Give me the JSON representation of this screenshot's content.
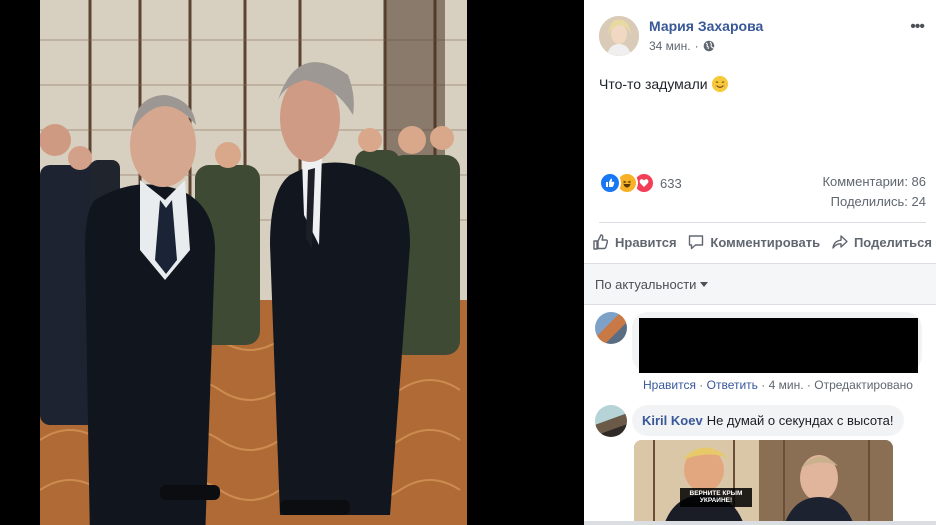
{
  "viewer": {
    "photo_icon": "photo-of-two-men-in-suits-talking",
    "background": "#000000"
  },
  "post": {
    "author": "Мария Захарова",
    "time": "34 мин.",
    "privacy_icon": "globe-icon",
    "more_label": "•••",
    "text": "Что-то задумали",
    "text_emoji": "smile-emoji-icon"
  },
  "reactions": {
    "count": "633",
    "types": [
      "like-icon",
      "haha-icon",
      "love-icon"
    ],
    "colors": {
      "like": "#1877f2",
      "haha": "#f7b125",
      "love": "#f33e58"
    }
  },
  "stats": {
    "comments": "Комментарии: 86",
    "shares": "Поделились: 24"
  },
  "actions": {
    "like": "Нравится",
    "comment": "Комментировать",
    "share": "Поделиться"
  },
  "sort": {
    "label": "По актуальности"
  },
  "comments": [
    {
      "like": "Нравится",
      "reply": "Ответить",
      "separator": "·",
      "time": "4 мин.",
      "edited": "Отредактировано"
    },
    {
      "author": "Kiril Koev",
      "text": "Не думай о секундах с высота!",
      "image_caption": "ВЕРНИТЕ КРЫМ УКРАИНЕ!"
    }
  ],
  "colors": {
    "link": "#385898",
    "muted": "#606770",
    "divider": "#dadde1"
  }
}
